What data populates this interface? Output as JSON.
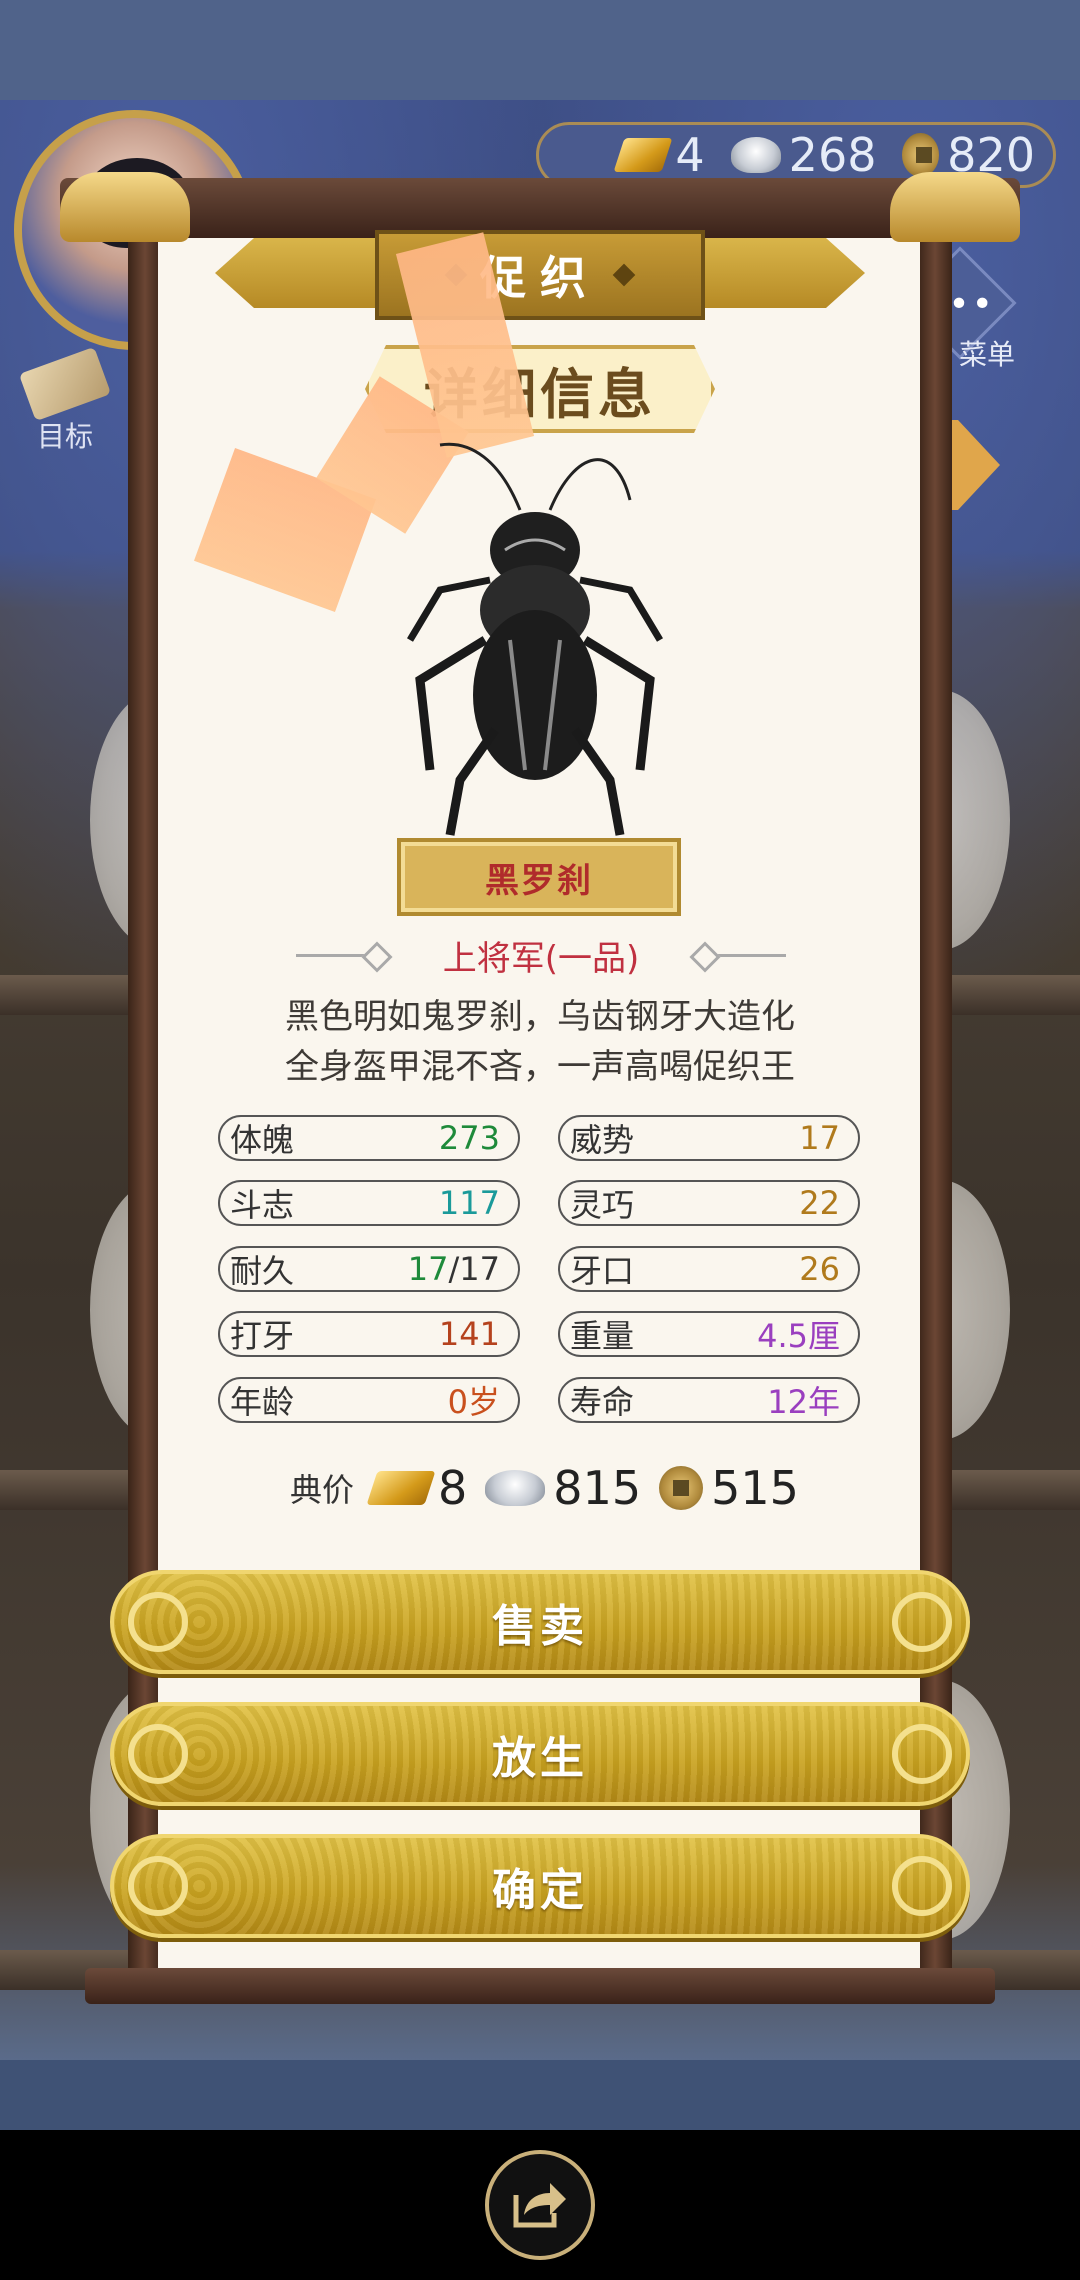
{
  "hud": {
    "currency": {
      "gold": "4",
      "silver": "268",
      "coin": "820"
    },
    "left_button_label": "目标",
    "menu_label": "菜单",
    "menu_dots": "•••"
  },
  "panel": {
    "title": "促织",
    "subtitle": "详细信息",
    "cricket_name": "黑罗刹",
    "rank": "上将军(一品)",
    "description": [
      "黑色明如鬼罗刹，乌齿钢牙大造化",
      "全身盔甲混不吝，一声高喝促织王"
    ],
    "stats_left": [
      {
        "label": "体魄",
        "value": "273",
        "color": "#1e8a3a"
      },
      {
        "label": "斗志",
        "value": "117",
        "color": "#1a9a9a"
      },
      {
        "label": "耐久",
        "value_main": "17",
        "value_rest": "/17",
        "color": "#1e8a3a"
      },
      {
        "label": "打牙",
        "value": "141",
        "color": "#b5421d"
      },
      {
        "label": "年龄",
        "value": "0岁",
        "color": "#c9501d"
      }
    ],
    "stats_right": [
      {
        "label": "威势",
        "value": "17",
        "color": "#b07a1c"
      },
      {
        "label": "灵巧",
        "value": "22",
        "color": "#b07a1c"
      },
      {
        "label": "牙口",
        "value": "26",
        "color": "#b07a1c"
      },
      {
        "label": "重量",
        "value": "4.5厘",
        "color": "#9a3fbf"
      },
      {
        "label": "寿命",
        "value": "12年",
        "color": "#9a3fbf"
      }
    ],
    "price": {
      "label": "典价",
      "gold": "8",
      "silver": "815",
      "coin": "515"
    }
  },
  "buttons": {
    "sell": "售卖",
    "release": "放生",
    "confirm": "确定"
  }
}
